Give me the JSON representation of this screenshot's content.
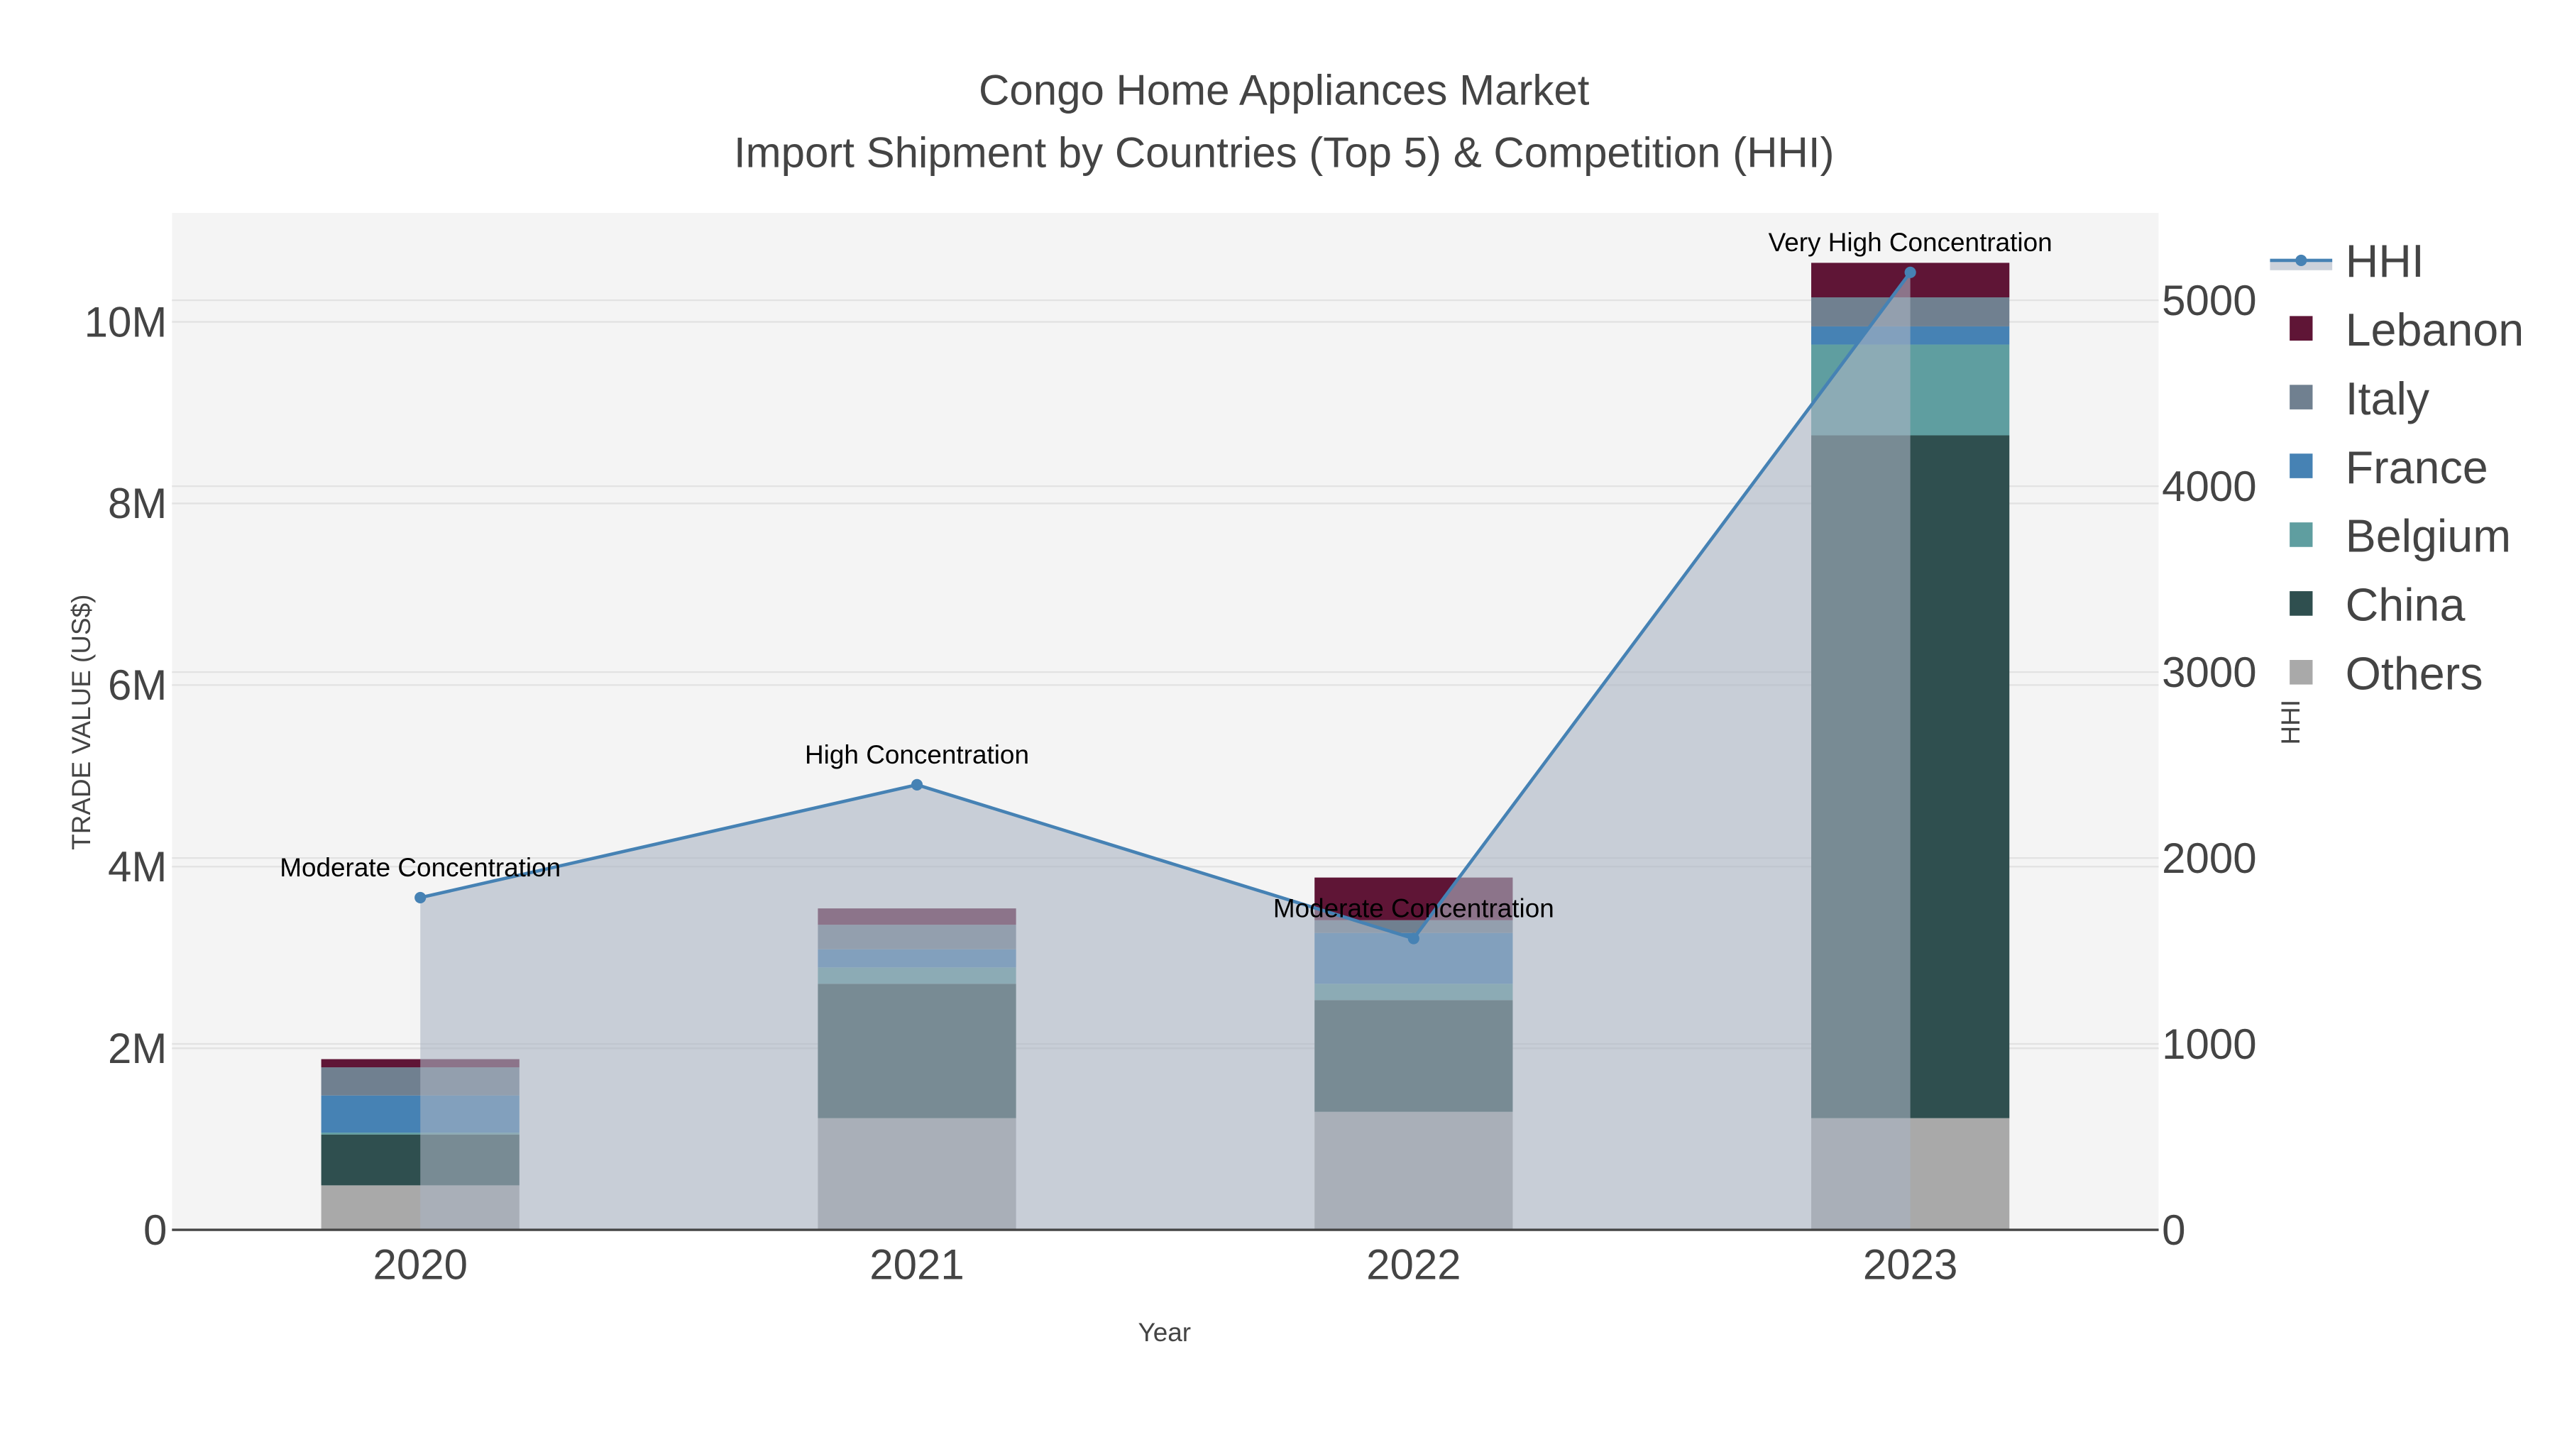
{
  "chart_data": {
    "type": "bar",
    "title": "Congo Home Appliances Market",
    "subtitle": "Import Shipment by Countries (Top 5) & Competition (HHI)",
    "xlabel": "Year",
    "ylabel": "TRADE VALUE (US$)",
    "y2label": "HHI",
    "categories": [
      "2020",
      "2021",
      "2022",
      "2023"
    ],
    "ylim": [
      0,
      11200000
    ],
    "y2lim": [
      0,
      5470
    ],
    "yticks": [
      {
        "v": 0,
        "label": "0"
      },
      {
        "v": 2000000,
        "label": "2M"
      },
      {
        "v": 4000000,
        "label": "4M"
      },
      {
        "v": 6000000,
        "label": "6M"
      },
      {
        "v": 8000000,
        "label": "8M"
      },
      {
        "v": 10000000,
        "label": "10M"
      }
    ],
    "y2ticks": [
      {
        "v": 0,
        "label": "0"
      },
      {
        "v": 1000,
        "label": "1000"
      },
      {
        "v": 2000,
        "label": "2000"
      },
      {
        "v": 3000,
        "label": "3000"
      },
      {
        "v": 4000,
        "label": "4000"
      },
      {
        "v": 5000,
        "label": "5000"
      }
    ],
    "grid": true,
    "legend_placement": "right",
    "series": [
      {
        "name": "Others",
        "color": "#a9a9a9",
        "values": [
          490000,
          1230000,
          1300000,
          1230000
        ]
      },
      {
        "name": "China",
        "color": "#2f4f4f",
        "values": [
          560000,
          1480000,
          1230000,
          7520000
        ]
      },
      {
        "name": "Belgium",
        "color": "#5f9ea0",
        "values": [
          20000,
          180000,
          180000,
          1000000
        ]
      },
      {
        "name": "France",
        "color": "#4682b4",
        "values": [
          410000,
          200000,
          560000,
          200000
        ]
      },
      {
        "name": "Italy",
        "color": "#708090",
        "values": [
          310000,
          270000,
          140000,
          320000
        ]
      },
      {
        "name": "Lebanon",
        "color": "#5f1536",
        "values": [
          90000,
          180000,
          470000,
          380000
        ]
      }
    ],
    "hhi": {
      "name": "HHI",
      "color": "#4682b4",
      "values": [
        1787,
        2394,
        1567,
        5150
      ],
      "annotations": [
        "Moderate Concentration",
        "High Concentration",
        "Moderate Concentration",
        "Very High Concentration"
      ]
    },
    "legend": [
      "HHI",
      "Lebanon",
      "Italy",
      "France",
      "Belgium",
      "China",
      "Others"
    ]
  }
}
